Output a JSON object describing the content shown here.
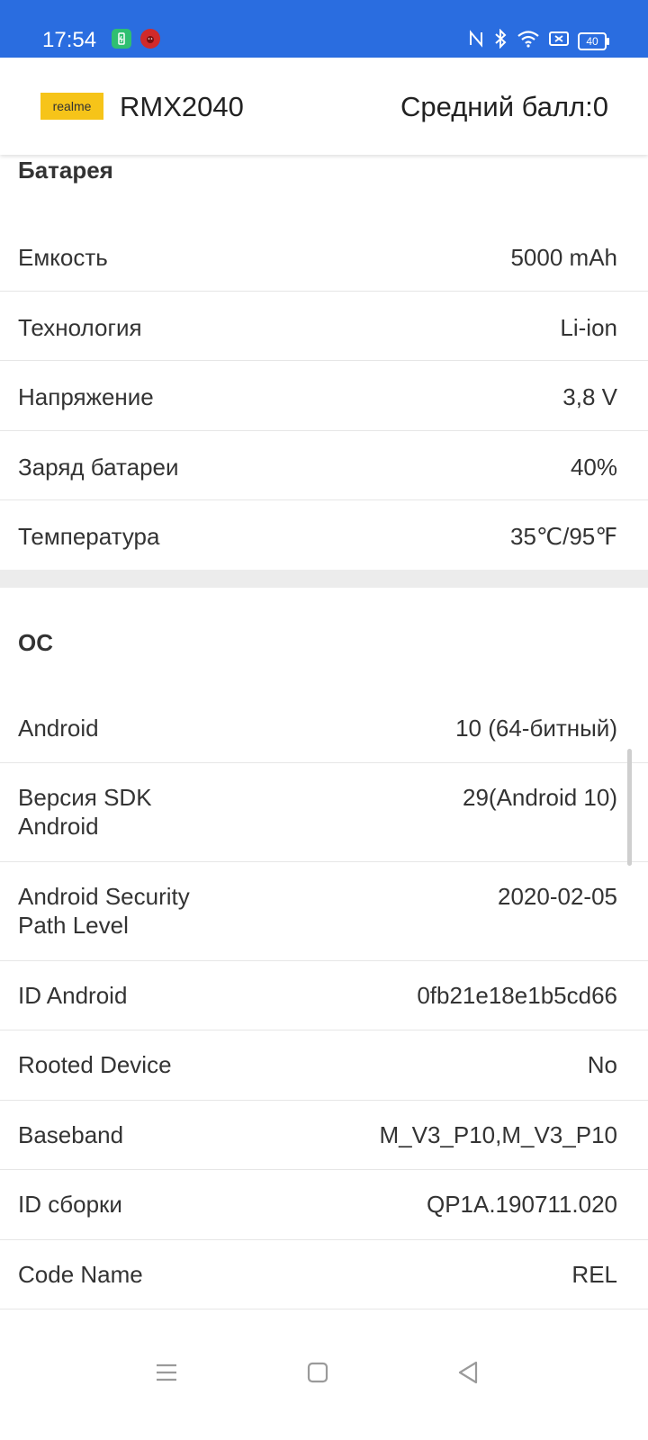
{
  "status": {
    "time": "17:54",
    "battery_level": "40"
  },
  "header": {
    "brand": "realme",
    "model": "RMX2040",
    "score": "Средний балл:0"
  },
  "battery_section": {
    "title": "Батарея",
    "rows": [
      {
        "label": "Емкость",
        "value": "5000 mAh"
      },
      {
        "label": "Технология",
        "value": "Li-ion"
      },
      {
        "label": "Напряжение",
        "value": "3,8 V"
      },
      {
        "label": "Заряд батареи",
        "value": "40%"
      },
      {
        "label": "Температура",
        "value": "35℃/95℉"
      }
    ]
  },
  "os_section": {
    "title": "ОС",
    "rows": [
      {
        "label": "Android",
        "value": "10 (64-битный)"
      },
      {
        "label": "Версия SDK Android",
        "value": "29(Android 10)"
      },
      {
        "label": "Android Security Path Level",
        "value": "2020-02-05"
      },
      {
        "label": "ID Android",
        "value": "0fb21e18e1b5cd66"
      },
      {
        "label": "Rooted Device",
        "value": "No"
      },
      {
        "label": "Baseband",
        "value": "M_V3_P10,M_V3_P10"
      },
      {
        "label": "ID сборки",
        "value": "QP1A.190711.020"
      },
      {
        "label": "Code Name",
        "value": "REL"
      }
    ]
  },
  "colors": {
    "status_bar": "#2a6de0",
    "brand_yellow": "#f6c419"
  }
}
